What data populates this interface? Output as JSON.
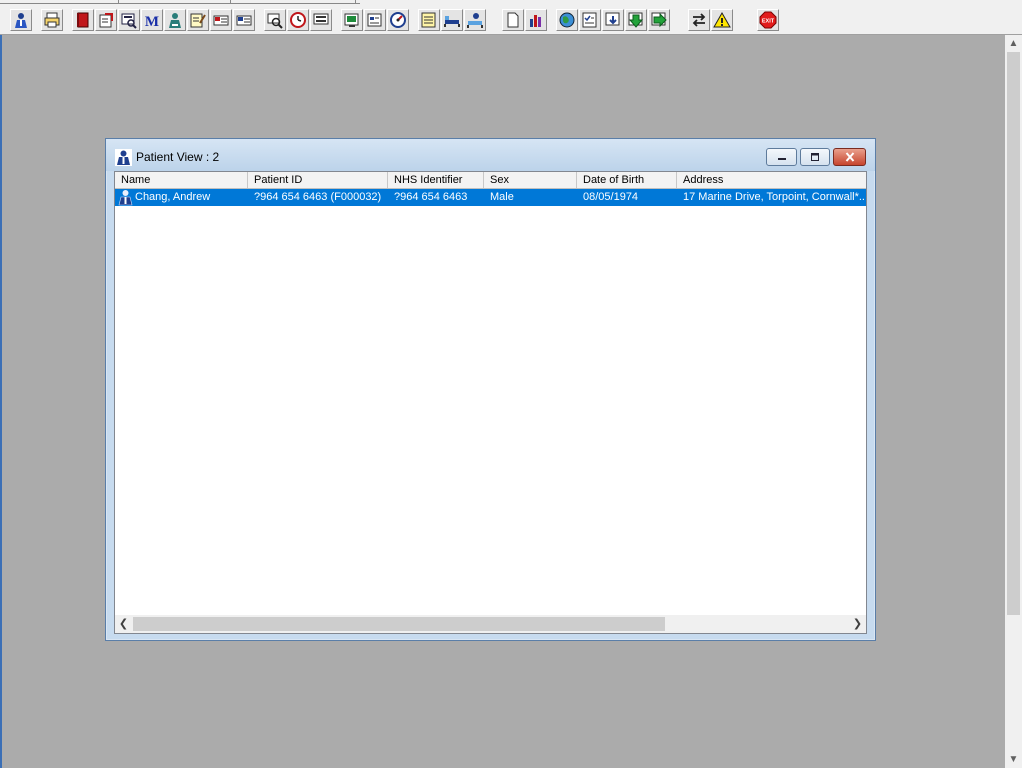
{
  "toolbar": {
    "buttons": [
      {
        "icon": "patient-icon"
      },
      {
        "icon": "printer-icon"
      },
      {
        "icon": "red-book-icon"
      },
      {
        "icon": "notes-icon"
      },
      {
        "icon": "document-search-icon"
      },
      {
        "icon": "mail-m-icon"
      },
      {
        "icon": "doctor-icon"
      },
      {
        "icon": "edit-note-icon"
      },
      {
        "icon": "card-icon"
      },
      {
        "icon": "card-alt-icon"
      },
      {
        "icon": "find-icon"
      },
      {
        "icon": "clock-icon"
      },
      {
        "icon": "monitor-icon"
      },
      {
        "icon": "chart-window-icon"
      },
      {
        "icon": "form-icon"
      },
      {
        "icon": "dial-icon"
      },
      {
        "icon": "list-icon"
      },
      {
        "icon": "bed-icon"
      },
      {
        "icon": "person-bed-icon"
      },
      {
        "icon": "blank-page-icon"
      },
      {
        "icon": "bar-chart-icon"
      },
      {
        "icon": "globe-icon"
      },
      {
        "icon": "checklist-icon"
      },
      {
        "icon": "download-icon"
      },
      {
        "icon": "green-arrow-down-icon"
      },
      {
        "icon": "green-arrow-right-icon"
      },
      {
        "icon": "swap-icon"
      },
      {
        "icon": "warning-icon"
      },
      {
        "icon": "exit-icon",
        "label": "EXIT"
      }
    ]
  },
  "window": {
    "title": "Patient View : 2",
    "columns": [
      "Name",
      "Patient ID",
      "NHS Identifier",
      "Sex",
      "Date of Birth",
      "Address"
    ],
    "rows": [
      {
        "name": "Chang, Andrew",
        "patient_id": "?964 654 6463 (F000032)",
        "nhs_identifier": "?964 654 6463",
        "sex": "Male",
        "date_of_birth": "08/05/1974",
        "address": "17 Marine Drive, Torpoint, Cornwall*..."
      }
    ]
  },
  "colors": {
    "selection": "#0078d7",
    "desktop": "#ababab",
    "window_frame": "#c7dbef",
    "close_button": "#c7452e"
  }
}
